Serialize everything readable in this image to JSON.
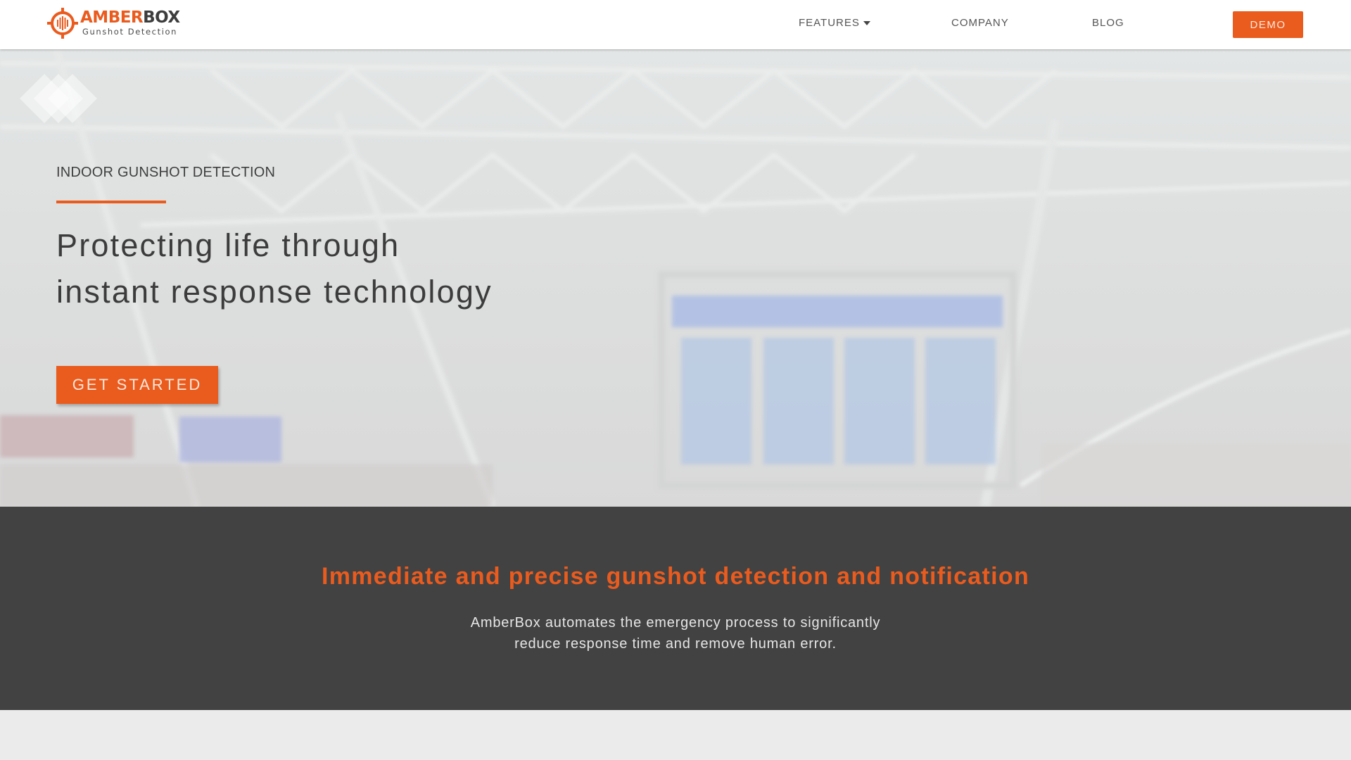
{
  "brand": {
    "name_part1": "AMBER",
    "name_part2": "BOX",
    "tagline": "Gunshot Detection",
    "logo_icon": "crosshair-soundwave-icon",
    "accent_color": "#ea5b1e",
    "dark_text_color": "#3d3d3d"
  },
  "nav": {
    "items": [
      {
        "label": "FEATURES",
        "has_dropdown": true,
        "icon": "caret-down-icon"
      },
      {
        "label": "COMPANY",
        "has_dropdown": false
      },
      {
        "label": "BLOG",
        "has_dropdown": false
      }
    ],
    "demo_label": "DEMO"
  },
  "hero": {
    "background_description": "airport terminal interior with departures board",
    "decorative_icon": "overlapping-diamonds-icon",
    "eyebrow": "INDOOR GUNSHOT DETECTION",
    "title_line1": "Protecting life through",
    "title_line2": "instant response technology",
    "cta_label": "GET STARTED"
  },
  "feature_section": {
    "title": "Immediate and precise gunshot detection and notification",
    "body_line1": "AmberBox automates the emergency process to significantly",
    "body_line2": "reduce response time and remove human error.",
    "background_color": "#424242"
  }
}
